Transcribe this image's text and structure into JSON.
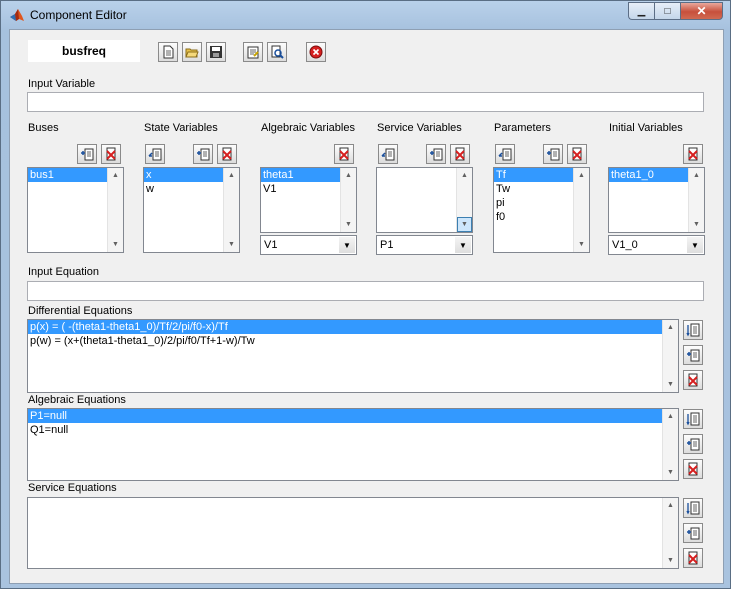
{
  "window": {
    "title": "Component Editor",
    "min_glyph": "▁",
    "max_glyph": "□",
    "close_glyph": "✕"
  },
  "component_name": "busfreq",
  "input_variable": {
    "label": "Input Variable",
    "value": ""
  },
  "columns": [
    {
      "key": "buses",
      "label": "Buses",
      "items": [
        "bus1"
      ],
      "selected": 0
    },
    {
      "key": "state",
      "label": "State Variables",
      "items": [
        "x",
        "w"
      ],
      "selected": 0
    },
    {
      "key": "algebraic",
      "label": "Algebraic Variables",
      "items": [
        "theta1",
        "V1"
      ],
      "selected": 0,
      "dropdown": "V1"
    },
    {
      "key": "service",
      "label": "Service Variables",
      "items": [],
      "dropdown": "P1"
    },
    {
      "key": "parameters",
      "label": "Parameters",
      "items": [
        "Tf",
        "Tw",
        "pi",
        "f0"
      ],
      "selected": 0
    },
    {
      "key": "initial",
      "label": "Initial Variables",
      "items": [
        "theta1_0"
      ],
      "selected": 0,
      "dropdown": "V1_0"
    }
  ],
  "input_equation": {
    "label": "Input Equation",
    "value": ""
  },
  "differential_equations": {
    "label": "Differential Equations",
    "items": [
      "p(x) = ( -(theta1-theta1_0)/Tf/2/pi/f0-x)/Tf",
      "p(w) = (x+(theta1-theta1_0)/2/pi/f0/Tf+1-w)/Tw"
    ],
    "selected": 0
  },
  "algebraic_equations": {
    "label": "Algebraic Equations",
    "items": [
      "P1=null",
      "Q1=null"
    ],
    "selected": 0
  },
  "service_equations": {
    "label": "Service Equations",
    "items": []
  },
  "colors": {
    "selection": "#3399ff",
    "panel": "#f0f0f0",
    "titlebar": "#b9d1ea"
  }
}
